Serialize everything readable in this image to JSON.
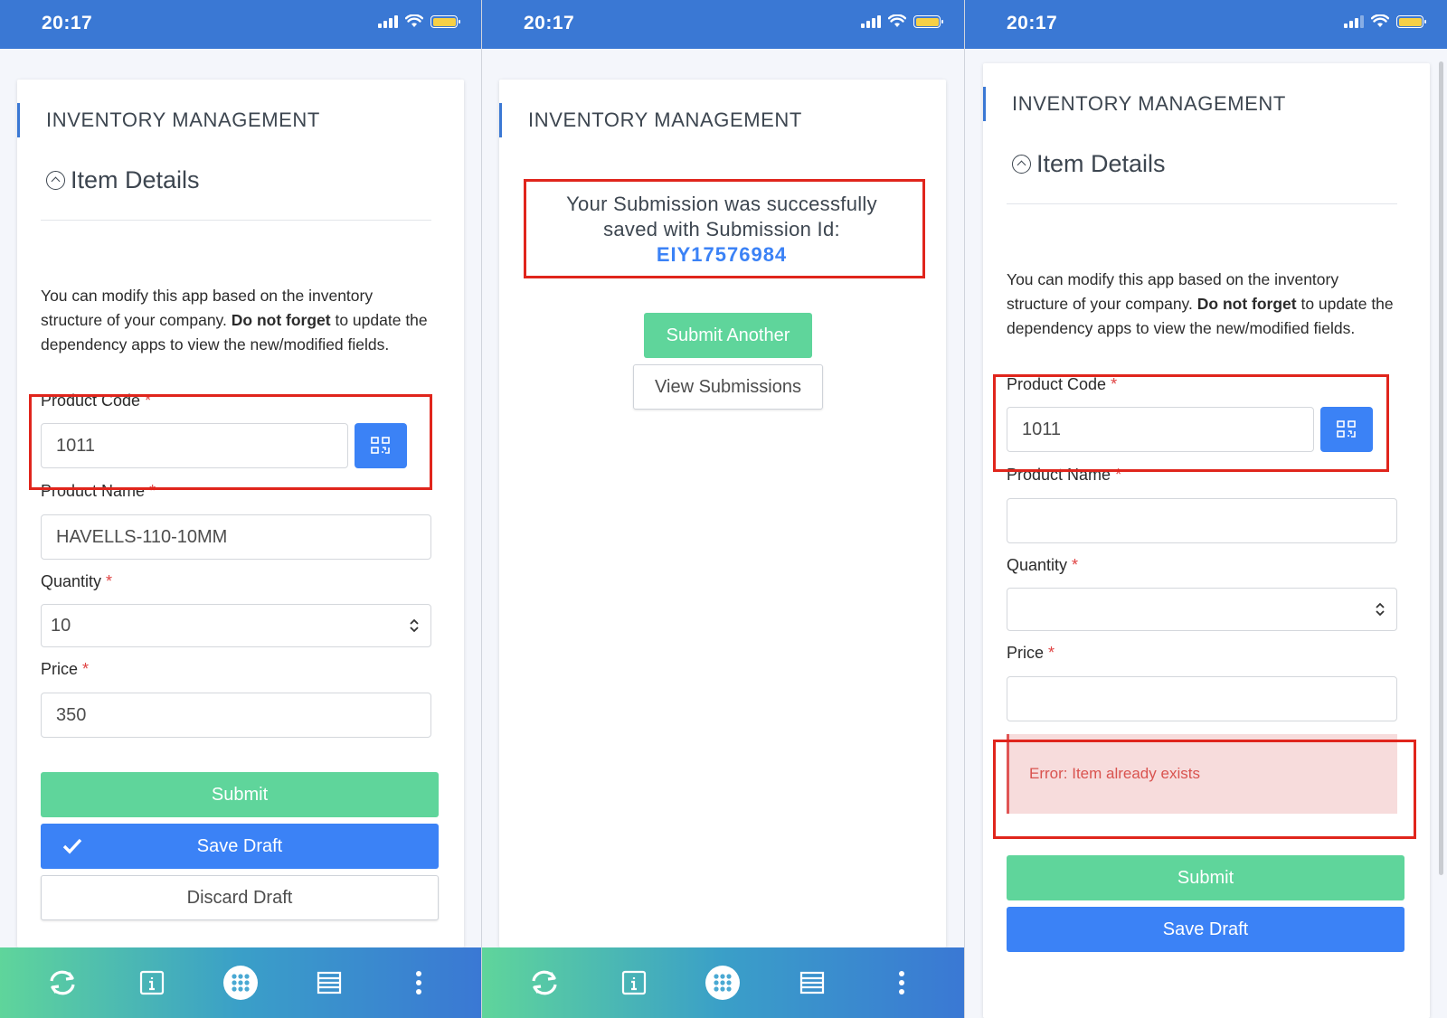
{
  "status": {
    "time": "20:17"
  },
  "app": {
    "title": "INVENTORY MANAGEMENT",
    "section": "Item Details"
  },
  "form": {
    "description_a": "You can modify this app based on the inventory structure of your company.",
    "description_bold": "Do not forget",
    "description_b": "to update the dependency apps to view the new/modified fields.",
    "product_code_label": "Product Code",
    "product_name_label": "Product Name",
    "quantity_label": "Quantity",
    "price_label": "Price",
    "required_mark": "*"
  },
  "screen1": {
    "product_code": "1011",
    "product_name": "HAVELLS-110-10MM",
    "quantity": "10",
    "price": "350",
    "submit_label": "Submit",
    "save_draft_label": "Save Draft",
    "discard_draft_label": "Discard Draft"
  },
  "screen2": {
    "success_line1": "Your Submission was successfully",
    "success_line2": "saved with Submission Id:",
    "submission_id": "EIY17576984",
    "submit_another_label": "Submit Another",
    "view_submissions_label": "View Submissions"
  },
  "screen3": {
    "product_code": "1011",
    "product_name": "",
    "quantity": "",
    "price": "",
    "error_message": "Error: Item already exists",
    "submit_label": "Submit",
    "save_draft_label": "Save Draft"
  },
  "bottom_nav": [
    "sync-icon",
    "info-icon",
    "apps-grid-icon",
    "list-icon",
    "more-vertical-icon"
  ],
  "colors": {
    "status_bar": "#3a78d4",
    "accent_blue": "#3b82f6",
    "accent_green": "#5fd59b",
    "highlight_red": "#e0251c",
    "error_bg": "#f7dcdc"
  }
}
